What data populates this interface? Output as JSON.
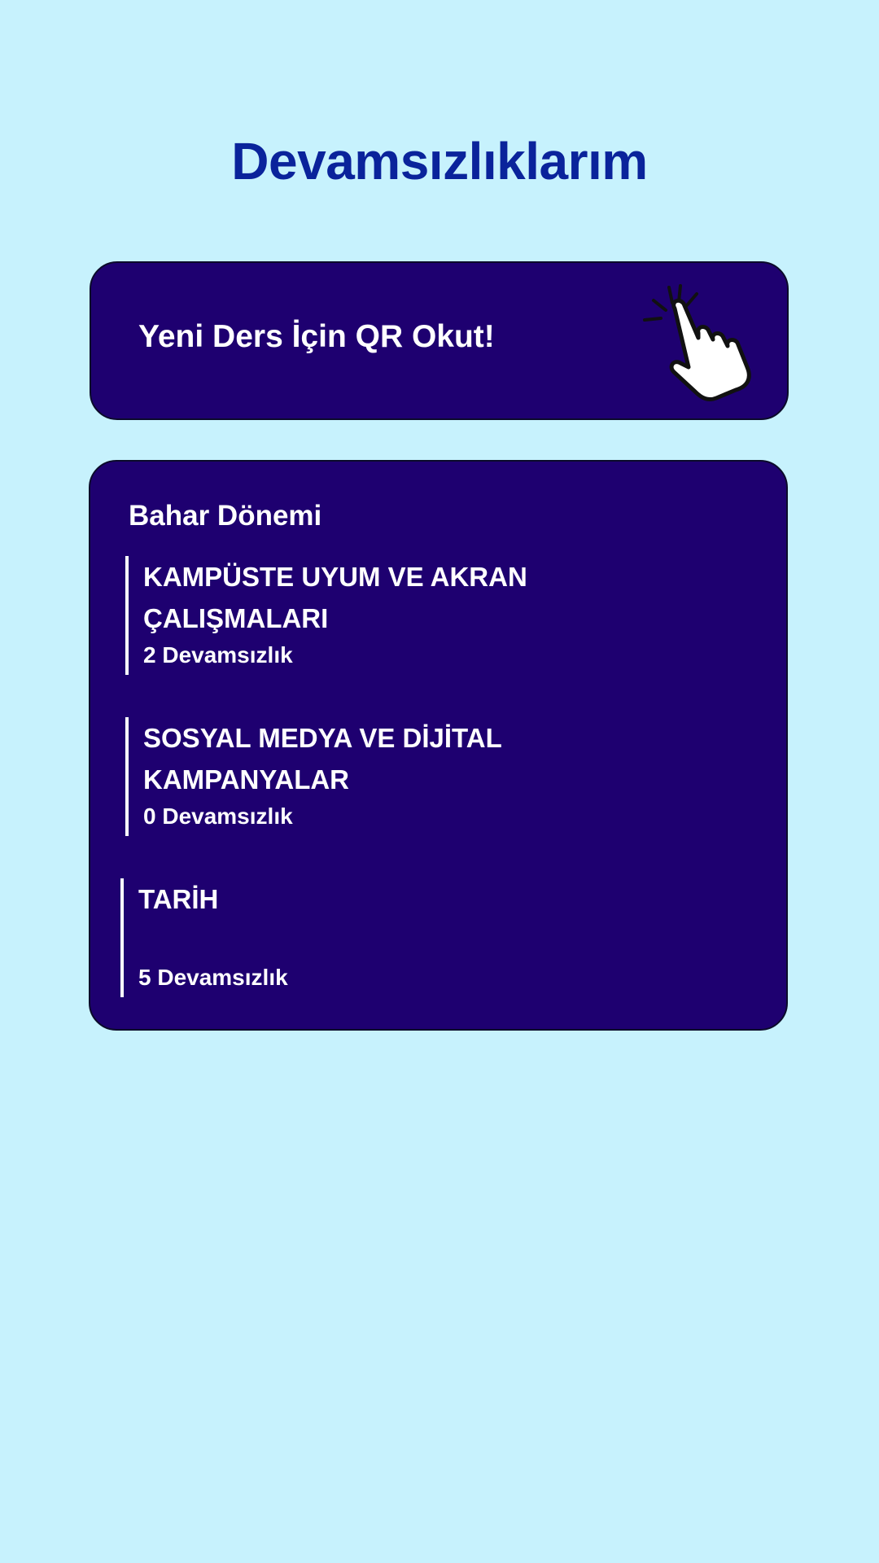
{
  "page": {
    "title": "Devamsızlıklarım"
  },
  "qr_card": {
    "label": "Yeni Ders İçin QR Okut!",
    "icon": "tap-hand-icon"
  },
  "term": {
    "title": "Bahar Dönemi",
    "courses": [
      {
        "name": "KAMPÜSTE UYUM VE AKRAN ÇALIŞMALARI",
        "absences": "2 Devamsızlık"
      },
      {
        "name": "SOSYAL MEDYA VE DİJİTAL KAMPANYALAR",
        "absences": "0 Devamsızlık"
      },
      {
        "name": "TARİH",
        "absences": "5 Devamsızlık"
      }
    ]
  },
  "colors": {
    "background": "#c7f2fd",
    "title": "#0a239b",
    "card": "#1e0070",
    "text": "#ffffff"
  }
}
